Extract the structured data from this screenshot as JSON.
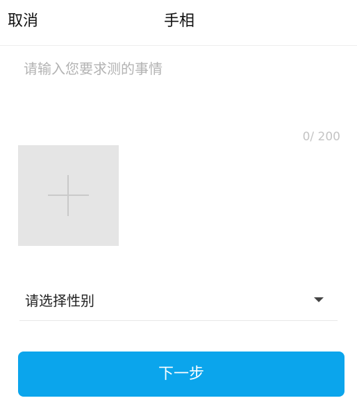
{
  "nav": {
    "cancel_label": "取消",
    "title": "手相"
  },
  "form": {
    "textarea_placeholder": "请输入您要求测的事情",
    "char_count": "0/ 200",
    "upload_icon": "plus-icon",
    "gender_select_value": "请选择性别",
    "gender_dropdown_icon": "caret-down-icon"
  },
  "actions": {
    "next_label": "下一步"
  },
  "colors": {
    "primary": "#0ba5ec",
    "upload_bg": "#e5e5e5"
  }
}
